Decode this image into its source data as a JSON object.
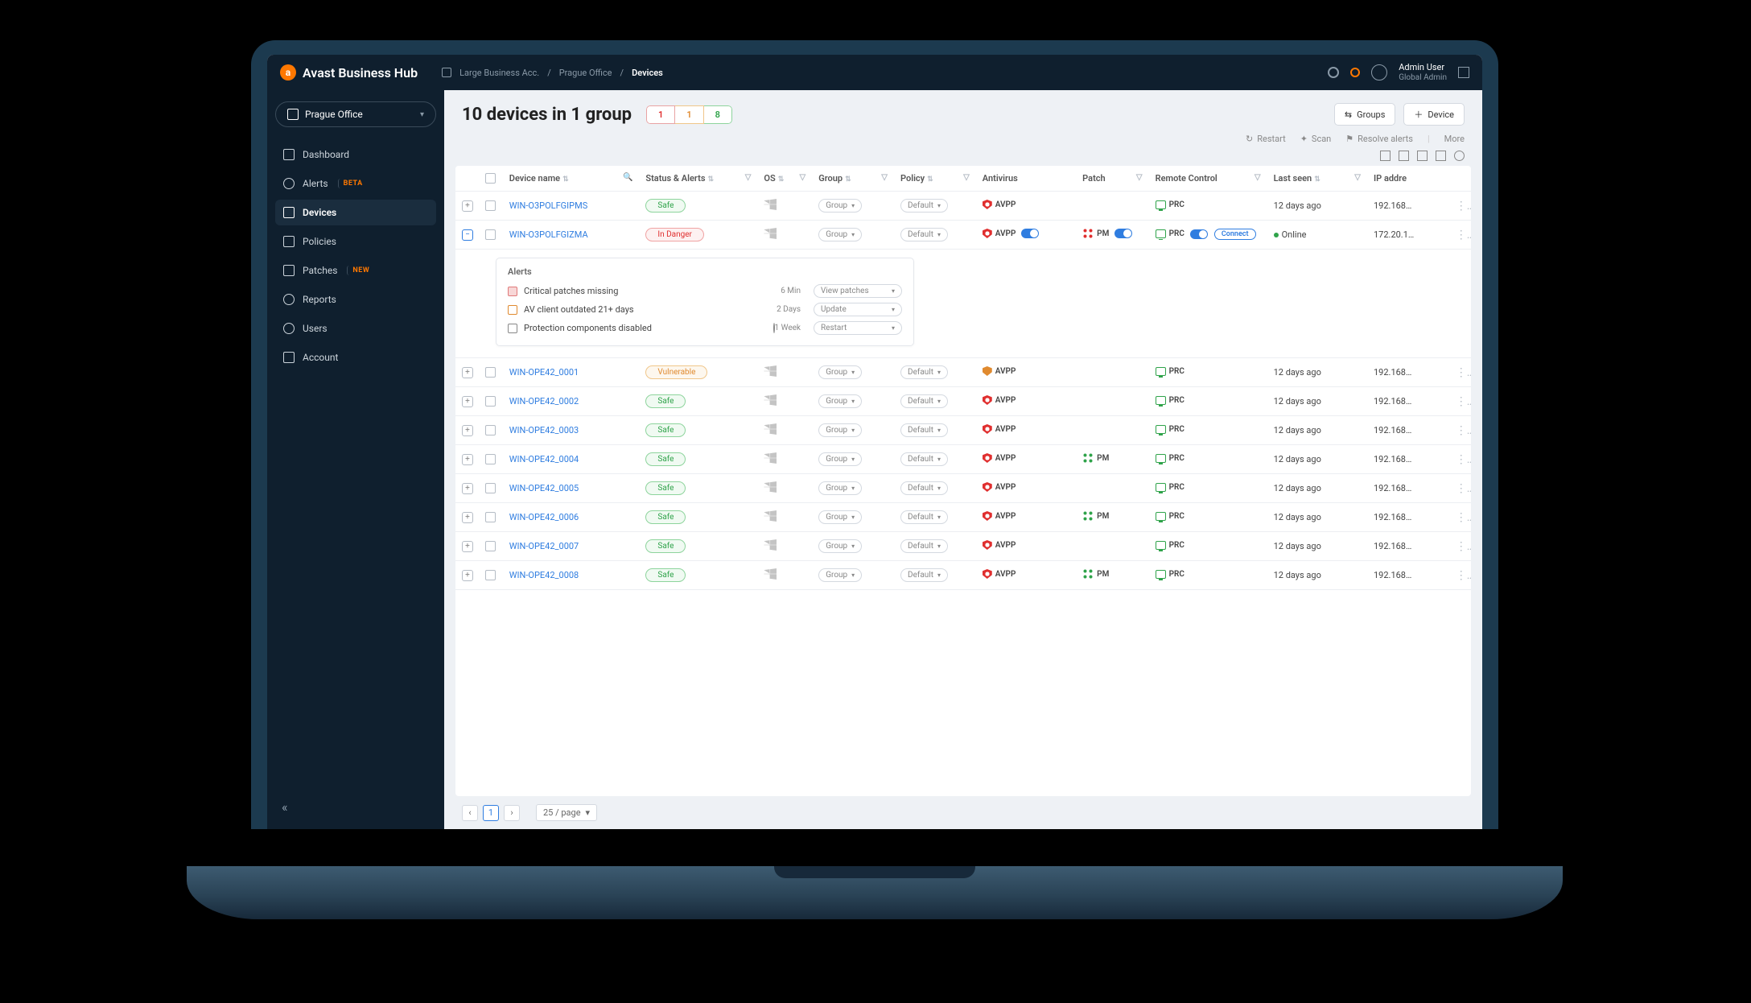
{
  "brand": "Avast Business Hub",
  "breadcrumbs": {
    "a": "Large Business Acc.",
    "b": "Prague Office",
    "c": "Devices"
  },
  "user": {
    "name": "Admin User",
    "role": "Global Admin"
  },
  "site_switcher": "Prague Office",
  "nav": {
    "dashboard": "Dashboard",
    "alerts": "Alerts",
    "alerts_badge": "BETA",
    "devices": "Devices",
    "policies": "Policies",
    "patches": "Patches",
    "patches_badge": "NEW",
    "reports": "Reports",
    "users": "Users",
    "account": "Account"
  },
  "page_title": "10 devices in 1 group",
  "counts": {
    "danger": "1",
    "vulnerable": "1",
    "safe": "8"
  },
  "head_buttons": {
    "groups": "Groups",
    "device": "Device"
  },
  "actions": {
    "restart": "Restart",
    "scan": "Scan",
    "resolve": "Resolve alerts",
    "more": "More"
  },
  "columns": {
    "name": "Device name",
    "status": "Status & Alerts",
    "os": "OS",
    "group": "Group",
    "policy": "Policy",
    "av": "Antivirus",
    "patch": "Patch",
    "rc": "Remote Control",
    "seen": "Last seen",
    "ip": "IP addre"
  },
  "group_label": "Group",
  "policy_label": "Default",
  "svc": {
    "avpp": "AVPP",
    "pm": "PM",
    "prc": "PRC"
  },
  "connect": "Connect",
  "online": "Online",
  "status_labels": {
    "safe": "Safe",
    "danger": "In Danger",
    "vuln": "Vulnerable"
  },
  "rows": [
    {
      "name": "WIN-O3POLFGIPMS",
      "status": "safe",
      "av": "red",
      "patch": "grey",
      "prc": true,
      "seen": "12 days ago",
      "ip": "192.168…"
    },
    {
      "name": "WIN-O3POLFGIZMA",
      "status": "danger",
      "av": "red",
      "av_toggle": true,
      "patch": "pm_red",
      "patch_toggle": true,
      "prc": true,
      "prc_toggle": true,
      "prc_connect": true,
      "seen": "Online",
      "online": true,
      "ip": "172.20.1…",
      "expanded": true
    },
    {
      "name": "WIN-OPE42_0001",
      "status": "vuln",
      "av": "orange",
      "patch": "grey",
      "prc": true,
      "seen": "12 days ago",
      "ip": "192.168…"
    },
    {
      "name": "WIN-OPE42_0002",
      "status": "safe",
      "av": "red",
      "patch": "grey",
      "prc": true,
      "seen": "12 days ago",
      "ip": "192.168…"
    },
    {
      "name": "WIN-OPE42_0003",
      "status": "safe",
      "av": "red",
      "patch": "grey",
      "prc": true,
      "seen": "12 days ago",
      "ip": "192.168…"
    },
    {
      "name": "WIN-OPE42_0004",
      "status": "safe",
      "av": "red",
      "patch": "pm_green",
      "prc": true,
      "seen": "12 days ago",
      "ip": "192.168…"
    },
    {
      "name": "WIN-OPE42_0005",
      "status": "safe",
      "av": "red",
      "patch": "grey",
      "prc": true,
      "seen": "12 days ago",
      "ip": "192.168…"
    },
    {
      "name": "WIN-OPE42_0006",
      "status": "safe",
      "av": "red",
      "patch": "pm_green",
      "prc": true,
      "seen": "12 days ago",
      "ip": "192.168…"
    },
    {
      "name": "WIN-OPE42_0007",
      "status": "safe",
      "av": "red",
      "patch": "grey",
      "prc": true,
      "seen": "12 days ago",
      "ip": "192.168…"
    },
    {
      "name": "WIN-OPE42_0008",
      "status": "safe",
      "av": "red",
      "patch": "pm_green",
      "prc": true,
      "seen": "12 days ago",
      "ip": "192.168…"
    }
  ],
  "alerts": {
    "heading": "Alerts",
    "items": [
      {
        "text": "Critical patches missing",
        "time": "6 Min",
        "action": "View patches"
      },
      {
        "text": "AV client outdated 21+ days",
        "time": "2 Days",
        "action": "Update"
      },
      {
        "text": "Protection components disabled",
        "time": "1 Week",
        "action": "Restart"
      }
    ]
  },
  "pager": {
    "page": "1",
    "size": "25 / page"
  }
}
